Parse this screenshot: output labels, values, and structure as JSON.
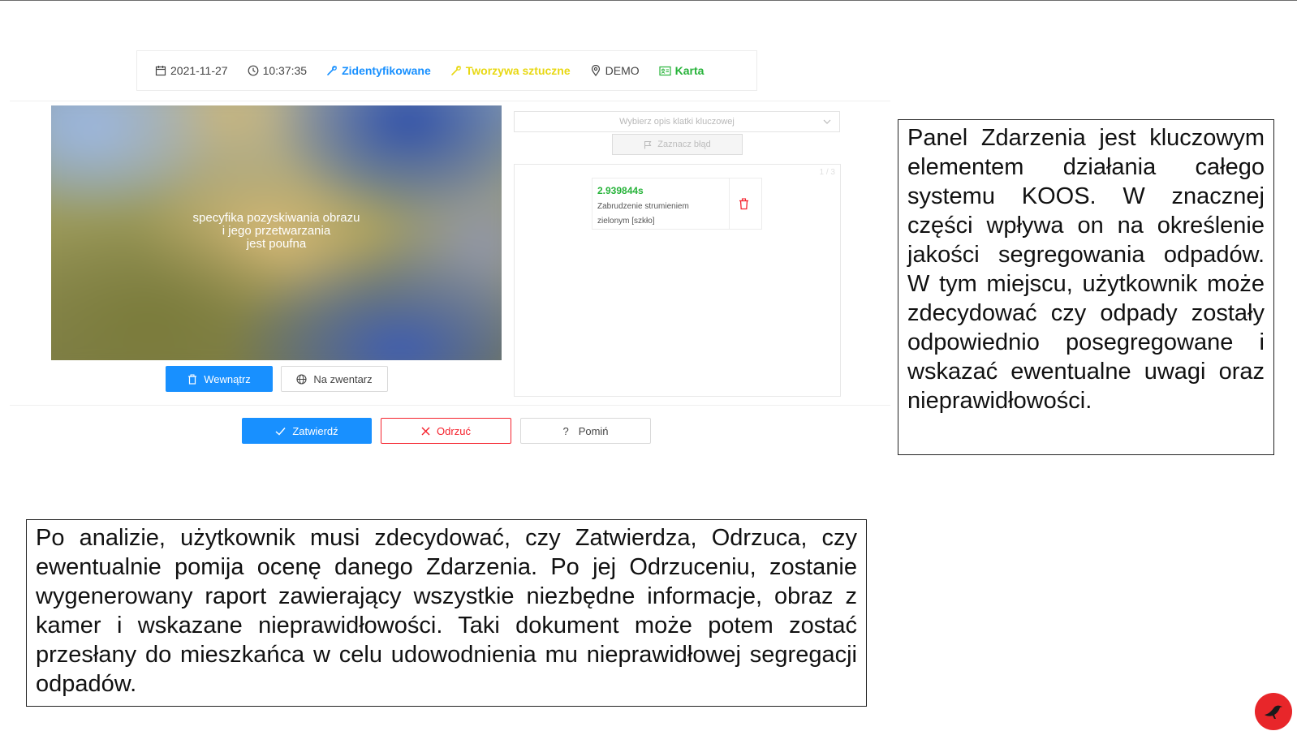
{
  "info_bar": {
    "date": "2021-11-27",
    "time": "10:37:35",
    "status": "Zidentyfikowane",
    "category": "Tworzywa sztuczne",
    "location": "DEMO",
    "card": "Karta",
    "colors": {
      "status": "#1890ff",
      "category": "#e8d813",
      "card": "#27b33a"
    }
  },
  "image": {
    "overlay_text_line1": "specyfika pozyskiwania obrazu",
    "overlay_text_line2": "i jego przetwarzania",
    "overlay_text_line3": "jest poufna"
  },
  "image_buttons": {
    "inside_label": "Wewnątrz",
    "outside_label": "Na zwentarz"
  },
  "keyframe": {
    "select_placeholder": "Wybierz opis klatki kluczowej",
    "mark_error_label": "Zaznacz błąd",
    "pager": "1 / 3"
  },
  "event": {
    "time": "2.939844s",
    "description": "Zabrudzenie strumieniem zielonym [szkło]"
  },
  "actions": {
    "approve_label": "Zatwierdź",
    "reject_label": "Odrzuć",
    "skip_label": "Pomiń",
    "colors": {
      "approve": "#1890ff",
      "reject": "#f5222d"
    }
  },
  "descriptions": {
    "right": "Panel Zdarzenia jest kluczowym elementem działania całego systemu KOOS. W znacznej części wpływa on na określenie jakości segregowania odpadów. W tym miejscu, użytkownik może zdecydować czy odpady zostały odpowiednio posegregowane i wskazać ewentualne uwagi oraz nieprawidłowości.",
    "bottom": "Po analizie, użytkownik musi zdecydować, czy Zatwierdza, Odrzuca, czy ewentualnie pomija ocenę danego Zdarzenia. Po jej Odrzuceniu, zostanie wygenerowany raport zawierający wszystkie niezbędne informacje, obraz z kamer i wskazane nieprawidłowości. Taki dokument może potem zostać przesłany do mieszkańca w celu udowodnienia mu nieprawidłowej segregacji odpadów."
  },
  "logo_icon": "bird-icon"
}
